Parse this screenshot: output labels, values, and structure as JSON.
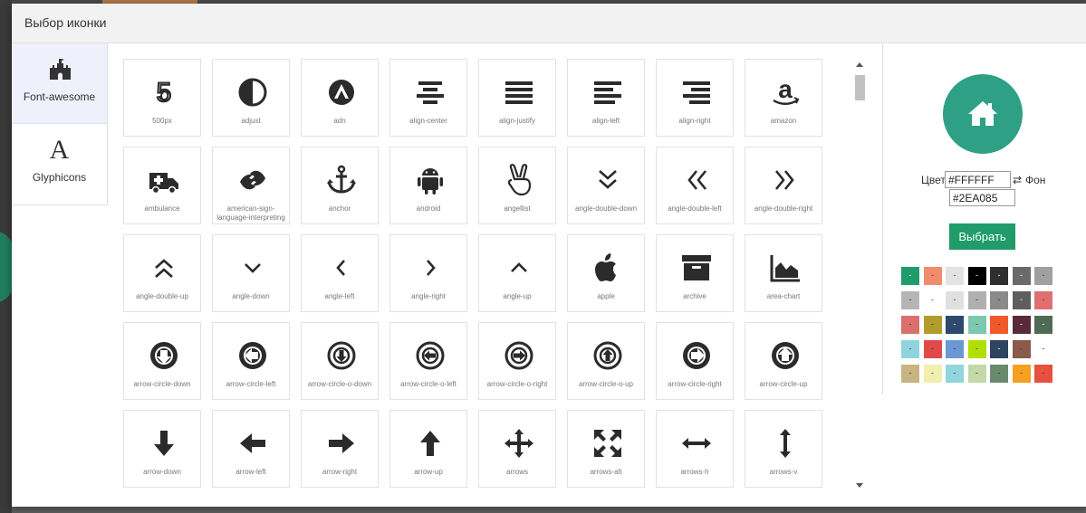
{
  "modal": {
    "title": "Выбор иконки"
  },
  "sidebar": {
    "items": [
      {
        "label": "Font-awesome",
        "icon": "castle-icon",
        "active": true
      },
      {
        "label": "Glyphicons",
        "icon": "letter-a-icon",
        "active": false
      }
    ]
  },
  "icons": [
    "500px",
    "adjust",
    "adn",
    "align-center",
    "align-justify",
    "align-left",
    "align-right",
    "amazon",
    "ambulance",
    "american-sign-language-interpreting",
    "anchor",
    "android",
    "angellist",
    "angle-double-down",
    "angle-double-left",
    "angle-double-right",
    "angle-double-up",
    "angle-down",
    "angle-left",
    "angle-right",
    "angle-up",
    "apple",
    "archive",
    "area-chart",
    "arrow-circle-down",
    "arrow-circle-left",
    "arrow-circle-o-down",
    "arrow-circle-o-left",
    "arrow-circle-o-right",
    "arrow-circle-o-up",
    "arrow-circle-right",
    "arrow-circle-up",
    "arrow-down",
    "arrow-left",
    "arrow-right",
    "arrow-up",
    "arrows",
    "arrows-alt",
    "arrows-h",
    "arrows-v"
  ],
  "preview": {
    "icon": "home-icon",
    "background": "#2EA085",
    "foreground": "#FFFFFF"
  },
  "color_form": {
    "color_label": "Цвет",
    "color_value": "#FFFFFF",
    "swap_icon": "swap-arrows-icon",
    "bg_label": "Фон",
    "bg_value": "#2EA085",
    "submit_label": "Выбрать"
  },
  "palette": {
    "label": "-",
    "colors": [
      "#1f9c6a",
      "#f28b6b",
      "#e3e3e3",
      "#000000",
      "#2f2f2f",
      "#6a6a6a",
      "#a0a0a0",
      "#b5b5b5",
      "#ffffff",
      "#e0e0e0",
      "#b0b0b0",
      "#8a8a8a",
      "#5e5e5e",
      "#e07070",
      "#d9706e",
      "#b29c2c",
      "#2c4a6b",
      "#7dc9b0",
      "#f05a2a",
      "#5a2a3a",
      "#4e6b55",
      "#8fd4dc",
      "#e04a4a",
      "#6a98d4",
      "#b0e000",
      "#2d4560",
      "#8a5a4a",
      "#ffffff",
      "#c8b480",
      "#f2eeb0",
      "#90d6dc",
      "#c4d8a8",
      "#6a8a70",
      "#f5a020",
      "#e85040"
    ]
  }
}
